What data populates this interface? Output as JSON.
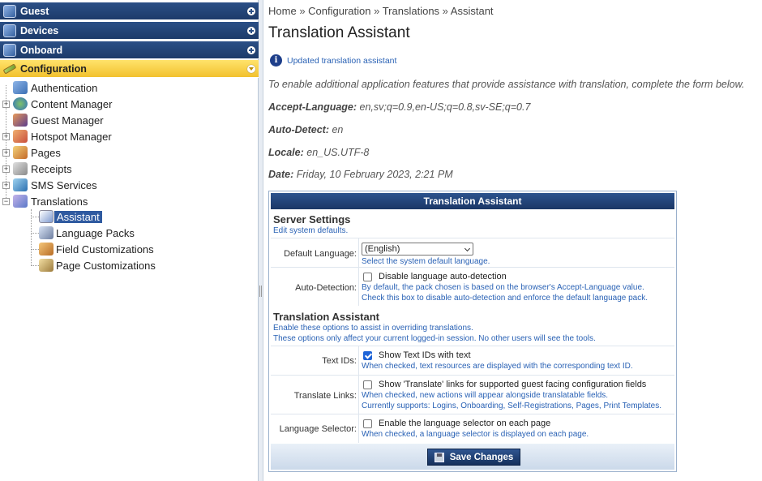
{
  "sidebar": {
    "top_items": [
      {
        "label": "Guest"
      },
      {
        "label": "Devices"
      },
      {
        "label": "Onboard"
      },
      {
        "label": "Configuration"
      }
    ],
    "tree": [
      {
        "label": "Authentication"
      },
      {
        "label": "Content Manager"
      },
      {
        "label": "Guest Manager"
      },
      {
        "label": "Hotspot Manager"
      },
      {
        "label": "Pages"
      },
      {
        "label": "Receipts"
      },
      {
        "label": "SMS Services"
      },
      {
        "label": "Translations"
      }
    ],
    "subtree": [
      {
        "label": "Assistant"
      },
      {
        "label": "Language Packs"
      },
      {
        "label": "Field Customizations"
      },
      {
        "label": "Page Customizations"
      }
    ]
  },
  "breadcrumb": {
    "items": [
      "Home",
      "Configuration",
      "Translations",
      "Assistant"
    ],
    "separator": "»"
  },
  "page": {
    "title": "Translation Assistant",
    "notice": "Updated translation assistant",
    "intro": "To enable additional application features that provide assistance with translation, complete the form below.",
    "accept_language_label": "Accept-Language:",
    "accept_language_value": "en,sv;q=0.9,en-US;q=0.8,sv-SE;q=0.7",
    "auto_detect_label": "Auto-Detect:",
    "auto_detect_value": "en",
    "locale_label": "Locale:",
    "locale_value": "en_US.UTF-8",
    "date_label": "Date:",
    "date_value": "Friday, 10 February 2023, 2:21 PM"
  },
  "form": {
    "header": "Translation Assistant",
    "server_settings": {
      "title": "Server Settings",
      "desc": "Edit system defaults.",
      "default_language_label": "Default Language:",
      "default_language_value": "(English)",
      "default_language_hint": "Select the system default language.",
      "auto_detection_label": "Auto-Detection:",
      "auto_detection_checkbox": "Disable language auto-detection",
      "auto_detection_checked": false,
      "auto_detection_hint_1": "By default, the pack chosen is based on the browser's Accept-Language value.",
      "auto_detection_hint_2": "Check this box to disable auto-detection and enforce the default language pack."
    },
    "translation_assistant": {
      "title": "Translation Assistant",
      "desc_1": "Enable these options to assist in overriding translations.",
      "desc_2": "These options only affect your current logged-in session. No other users will see the tools.",
      "text_ids_label": "Text IDs:",
      "text_ids_checkbox": "Show Text IDs with text",
      "text_ids_checked": true,
      "text_ids_hint": "When checked, text resources are displayed with the corresponding text ID.",
      "translate_links_label": "Translate Links:",
      "translate_links_checkbox": "Show 'Translate' links for supported guest facing configuration fields",
      "translate_links_checked": false,
      "translate_links_hint_1": "When checked, new actions will appear alongside translatable fields.",
      "translate_links_hint_2": "Currently supports: Logins, Onboarding, Self-Registrations, Pages, Print Templates.",
      "language_selector_label": "Language Selector:",
      "language_selector_checkbox": "Enable the language selector on each page",
      "language_selector_checked": false,
      "language_selector_hint": "When checked, a language selector is displayed on each page."
    },
    "save_label": "Save Changes"
  },
  "colors": {
    "nav_blue": "#1d3b6a",
    "nav_active": "#f2c12e",
    "link_blue": "#2a62b5",
    "selected_bg": "#2f5aa0"
  }
}
